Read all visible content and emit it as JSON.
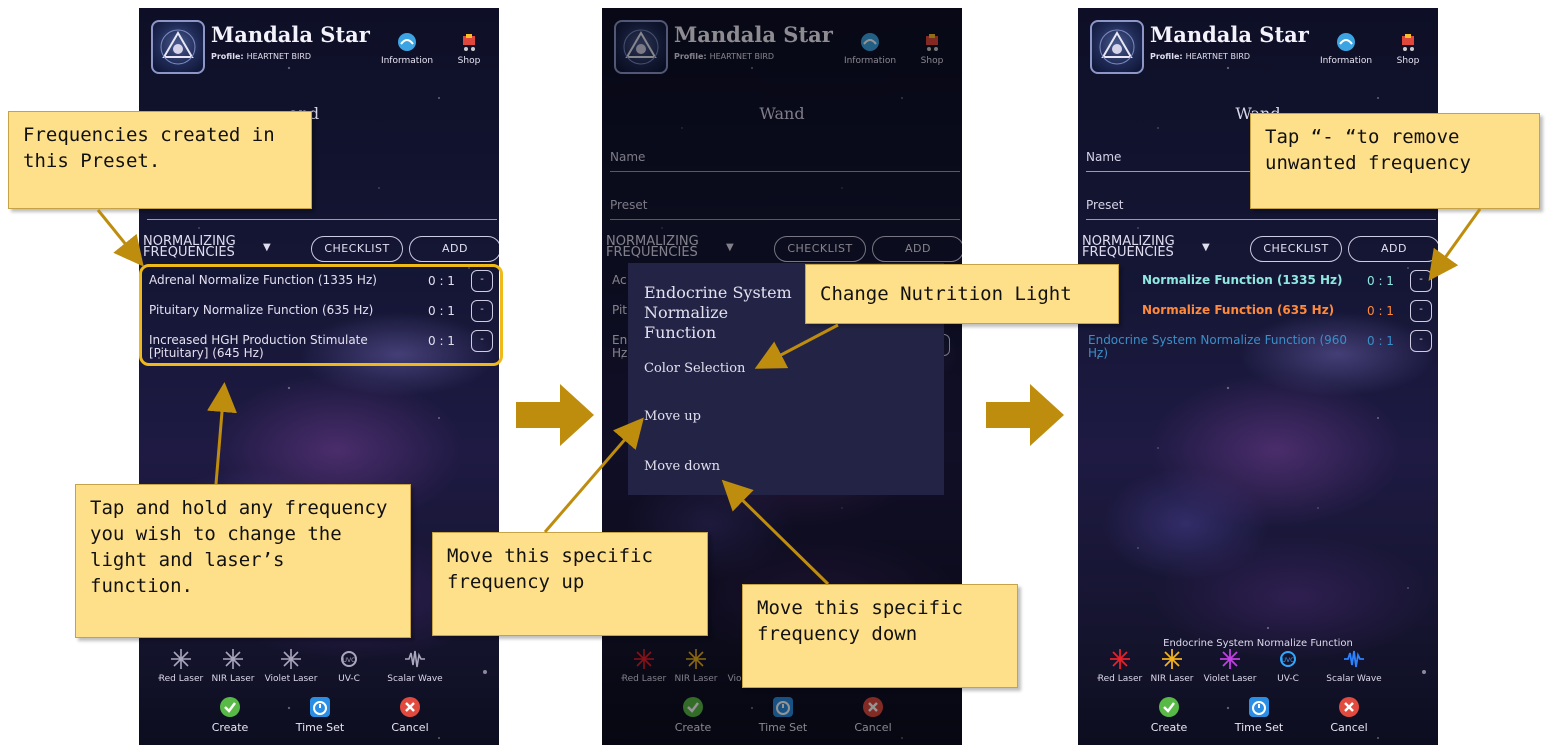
{
  "app": {
    "title": "Mandala Star",
    "profile_label": "Profile:",
    "profile_name": "HEARTNET BIRD",
    "info_label": "Information",
    "shop_label": "Shop"
  },
  "wand": {
    "title": "Wand",
    "title_partial": "and",
    "name_label": "Name",
    "preset_label": "Preset",
    "dropdown_label": "NORMALIZING FREQUENCIES",
    "checklist_label": "CHECKLIST",
    "add_label": "ADD"
  },
  "screen1": {
    "frequencies": [
      {
        "name": "Adrenal Normalize Function (1335 Hz)",
        "value": "0 : 1",
        "button": "-"
      },
      {
        "name": "Pituitary Normalize Function (635 Hz)",
        "value": "0 : 1",
        "button": "-"
      },
      {
        "name": "Increased HGH Production Stimulate [Pituitary] (645 Hz)",
        "value": "0 : 1",
        "button": "-"
      }
    ]
  },
  "screen2": {
    "visible_rows": [
      {
        "name": "Ac",
        "value": "",
        "button": ""
      },
      {
        "name": "Pit",
        "value": "",
        "button": ""
      },
      {
        "name": "En Hz",
        "value": "",
        "button": ""
      }
    ],
    "bottom_label": "Endocrine S",
    "menu": {
      "title": "Endocrine System Normalize Function",
      "items": [
        "Color Selection",
        "Move up",
        "Move down"
      ]
    }
  },
  "screen3": {
    "frequencies": [
      {
        "name": "Normalize Function (1335 Hz)",
        "value": "0 : 1",
        "button": "-",
        "color": "#8fe8e0"
      },
      {
        "name": "Normalize Function (635 Hz)",
        "value": "0 : 1",
        "button": "-",
        "color": "#ff8a3a"
      },
      {
        "name": "Endocrine System Normalize Function (960 Hz)",
        "value": "0 : 1",
        "button": "-",
        "color": "#3a8fc8"
      }
    ],
    "bottom_label": "Endocrine System Normalize Function"
  },
  "lasers": [
    {
      "label": "Red Laser",
      "icon": "starburst-icon",
      "color": "#e8202a"
    },
    {
      "label": "NIR Laser",
      "icon": "starburst-icon",
      "color": "#f2b31c"
    },
    {
      "label": "Violet Laser",
      "icon": "starburst-icon",
      "color": "#c43ee6"
    },
    {
      "label": "UV-C",
      "icon": "uvc-icon",
      "color": "#2fa8ff"
    },
    {
      "label": "Scalar Wave",
      "icon": "wave-icon",
      "color": "#2c83ff"
    }
  ],
  "actions": {
    "create_label": "Create",
    "timeset_label": "Time Set",
    "cancel_label": "Cancel"
  },
  "annotations": {
    "frequencies_created": "Frequencies created in this Preset.",
    "tap_hold": "Tap and hold any frequency you wish to change the light and laser’s function.",
    "change_light": "Change Nutrition Light",
    "move_up": "Move this specific frequency up",
    "move_down": "Move this specific frequency down",
    "remove": "Tap “- “to remove unwanted frequency"
  },
  "colors": {
    "annotation_bg": "#ffe08a",
    "highlight": "#f0b91a",
    "arrow": "#bf8d0e"
  }
}
